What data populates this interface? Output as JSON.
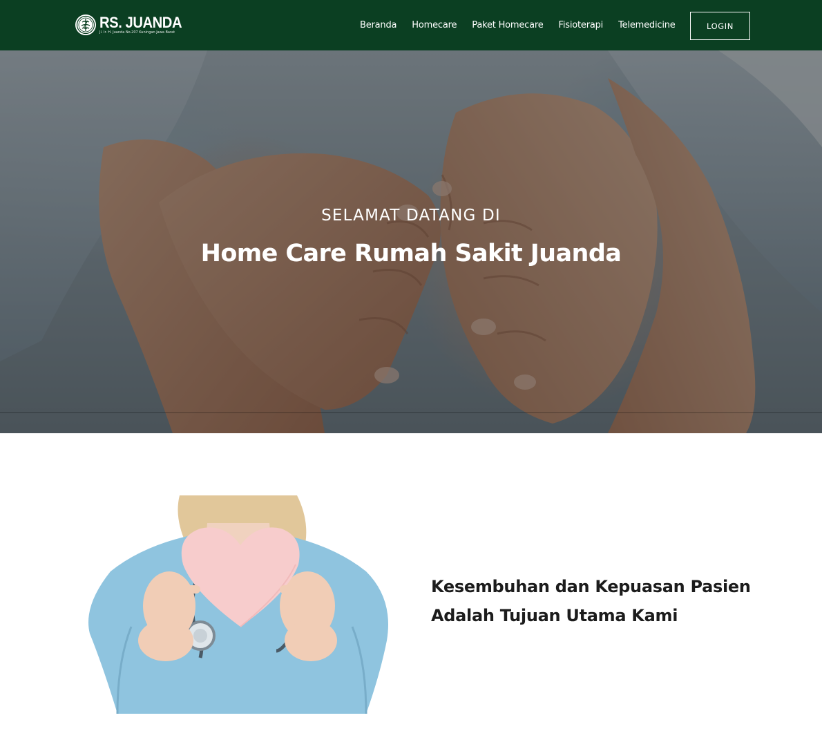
{
  "brand": {
    "name": "RS. JUANDA",
    "address": "Jl. Ir. H. Juanda No.207 Kuningan Jawa Barat",
    "emblem_icon": "hospital-emblem-icon"
  },
  "nav": {
    "items": [
      {
        "label": "Beranda"
      },
      {
        "label": "Homecare"
      },
      {
        "label": "Paket Homecare"
      },
      {
        "label": "Fisioterapi"
      },
      {
        "label": "Telemedicine"
      }
    ],
    "login_label": "LOGIN"
  },
  "hero": {
    "kicker": "SELAMAT DATANG DI",
    "title": "Home Care Rumah Sakit Juanda"
  },
  "about": {
    "heading_line1": "Kesembuhan dan Kepuasan Pasien",
    "heading_line2": "Adalah Tujuan Utama Kami"
  },
  "colors": {
    "navbar_bg": "#0b3f22",
    "text_dark": "#1c1c1c",
    "heart_pink": "#f7cccc",
    "scrubs_blue": "#8fc4df"
  }
}
